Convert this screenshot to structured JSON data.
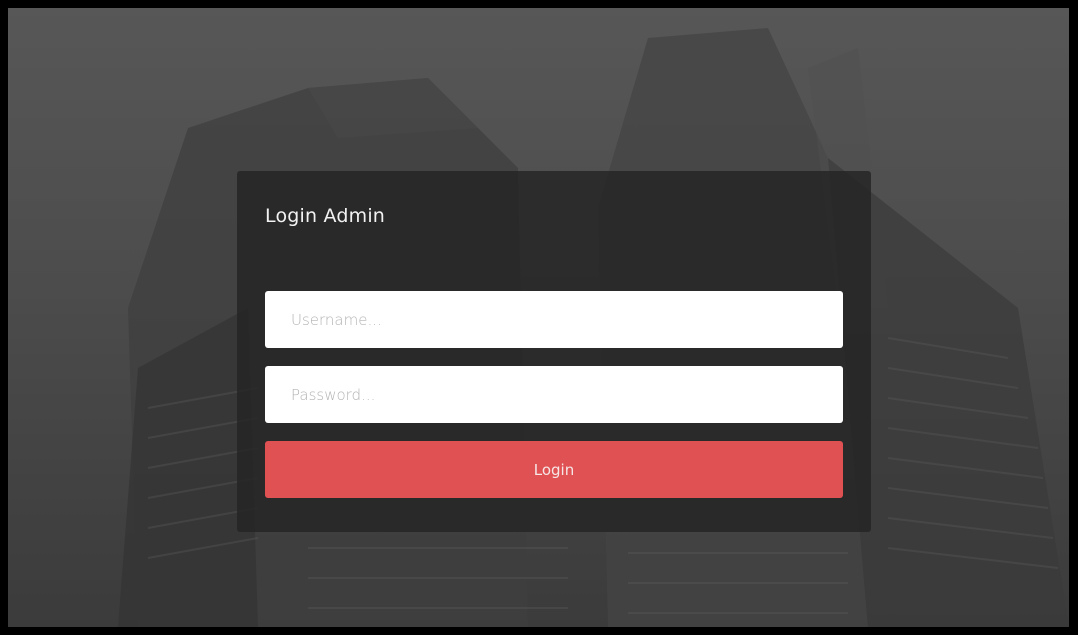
{
  "page": {
    "title": "Login Admin"
  },
  "form": {
    "username_placeholder": "Username...",
    "username_value": "",
    "password_placeholder": "Password...",
    "password_value": "",
    "login_label": "Login"
  },
  "colors": {
    "button": "#e05153",
    "card": "#222222",
    "background": "#4c4c4c"
  }
}
